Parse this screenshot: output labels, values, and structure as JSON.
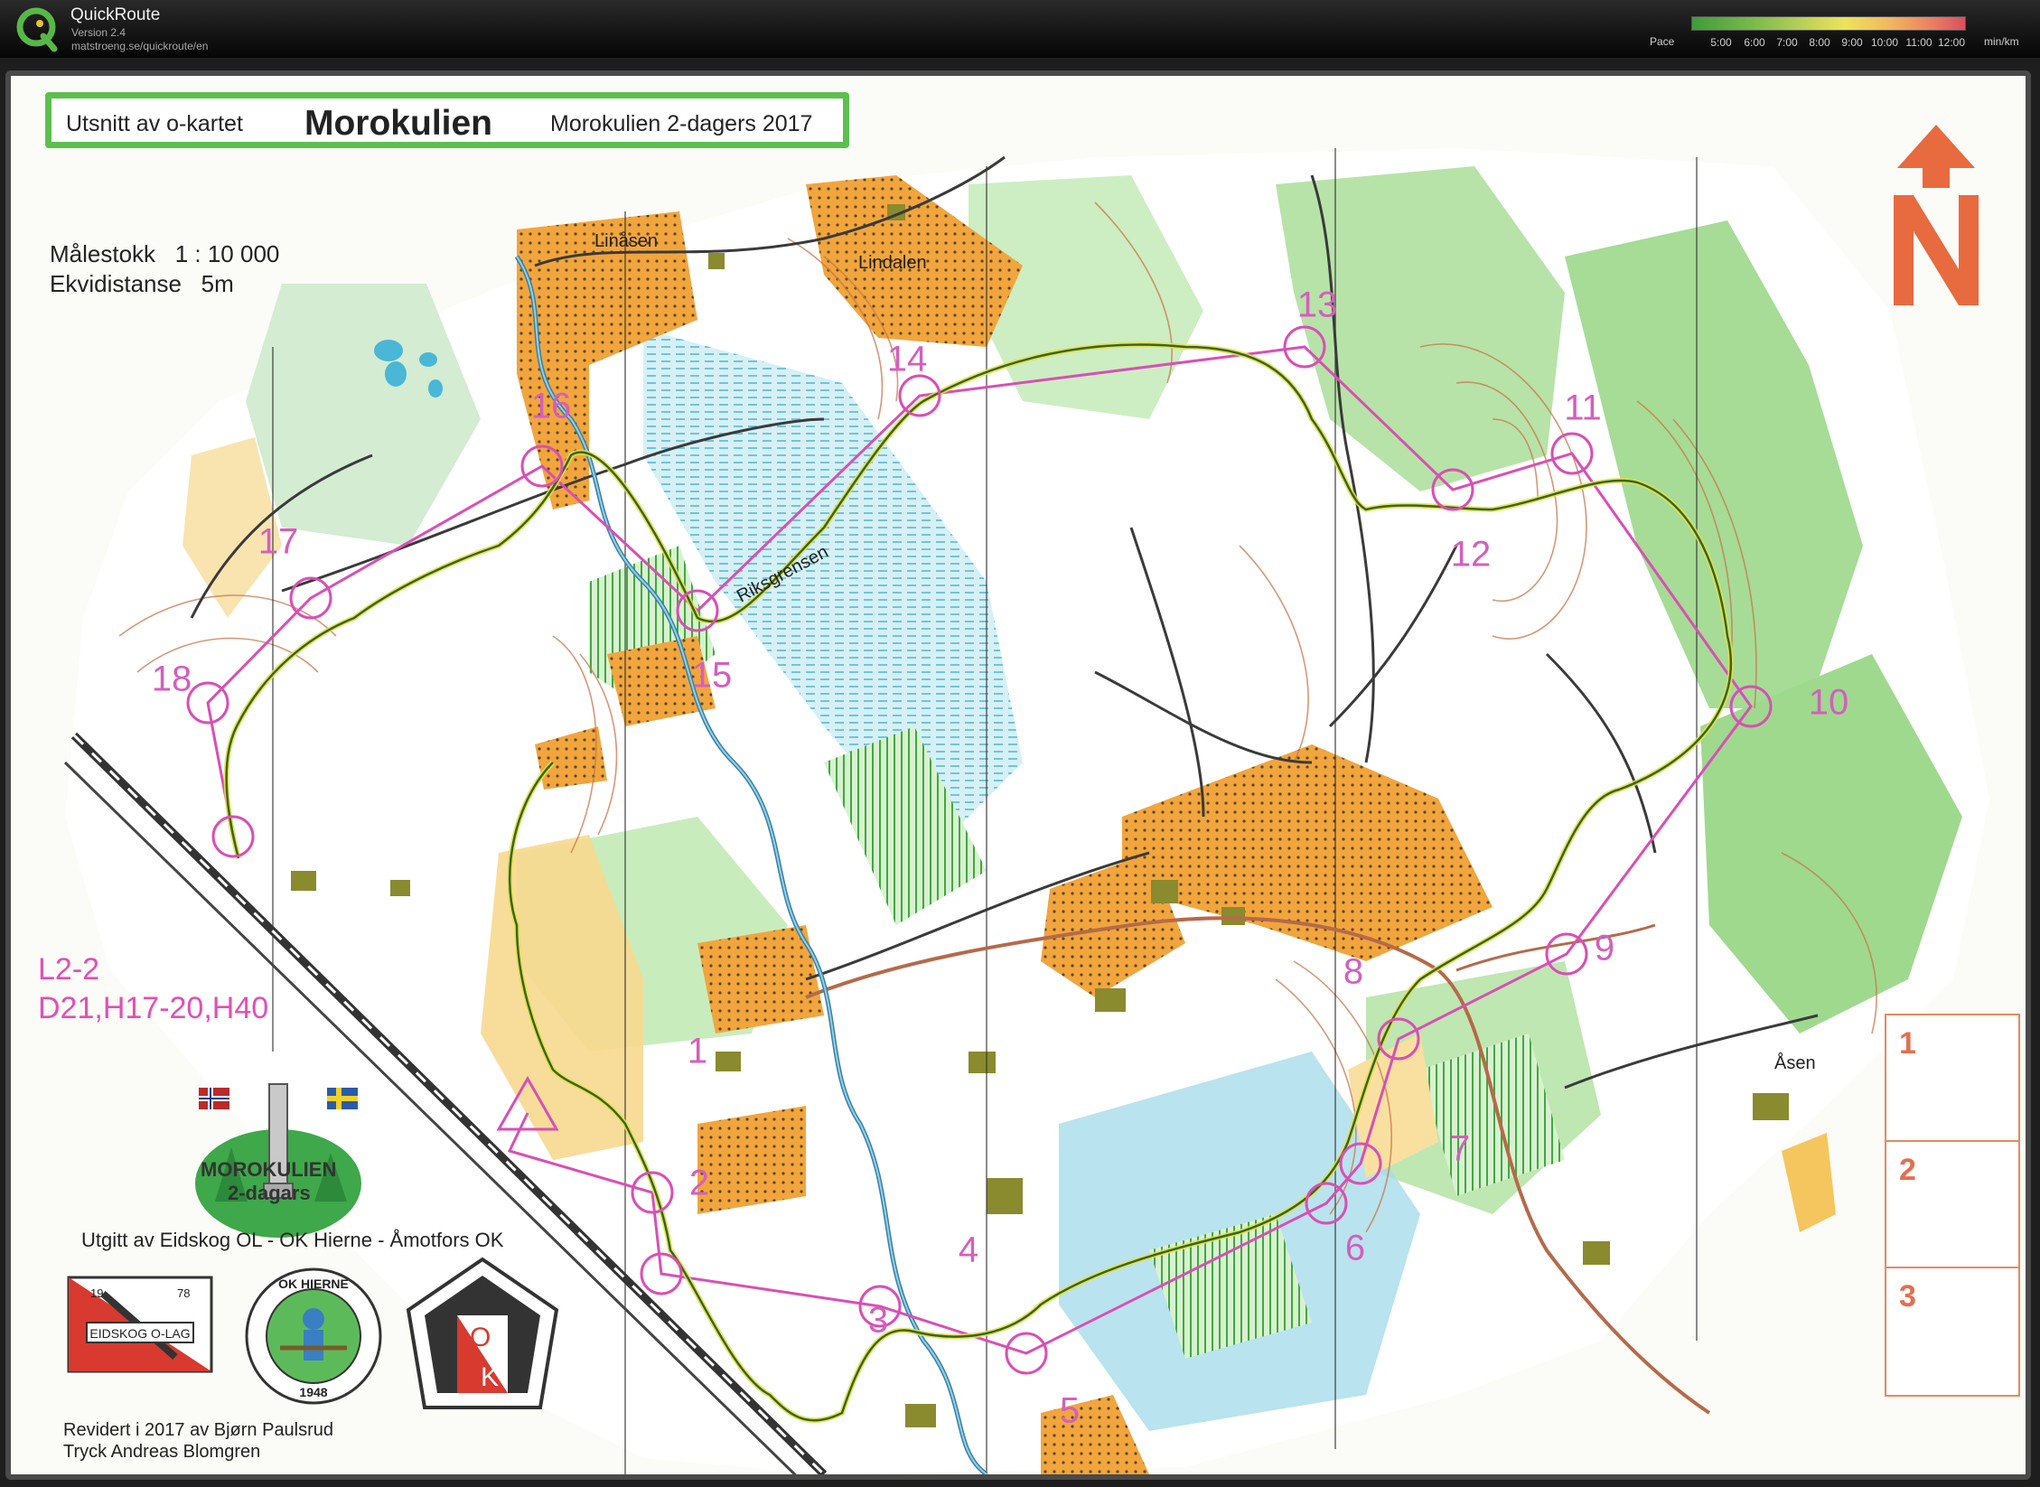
{
  "app": {
    "title": "QuickRoute",
    "version": "Version 2.4",
    "url": "matstroeng.se/quickroute/en",
    "logo_letter": "Q"
  },
  "pace_legend": {
    "label": "Pace",
    "ticks": [
      "5:00",
      "6:00",
      "7:00",
      "8:00",
      "9:00",
      "10:00",
      "11:00",
      "12:00"
    ],
    "unit": "min/km"
  },
  "map": {
    "title_excerpt": "Utsnitt av o-kartet",
    "title_main": "Morokulien",
    "title_event": "Morokulien 2-dagers 2017",
    "scale": "Målestokk   1 : 10 000",
    "contour": "Ekvidistanse   5m",
    "course_code": "L2-2",
    "course_classes": "D21,H17-20,H40",
    "event_logo_line1": "MOROKULIEN",
    "event_logo_line2": "2-dagars",
    "publisher": "Utgitt av Eidskog OL - OK Hierne - Åmotfors OK",
    "club_eidskog": {
      "name": "EIDSKOG O-LAG",
      "year_left": "19",
      "year_right": "78"
    },
    "club_hierne": {
      "name": "OK HIERNE",
      "year": "1948"
    },
    "club_amotfors": {
      "letters": [
        "O",
        "K"
      ]
    },
    "revised": "Revidert i 2017 av Bjørn Paulsrud",
    "printer": "Tryck Andreas Blomgren",
    "places": [
      "Linåsen",
      "Lindalen",
      "Riksgrensen",
      "Åsen"
    ],
    "legs": [
      "1",
      "2",
      "3"
    ],
    "controls": [
      "1",
      "2",
      "3",
      "4",
      "5",
      "6",
      "7",
      "8",
      "9",
      "10",
      "11",
      "12",
      "13",
      "14",
      "15",
      "16",
      "17",
      "18"
    ]
  },
  "colors": {
    "course": "#d94fb5",
    "route": "#2f6a1f",
    "track_highlight": "#eedb4a",
    "open_land": "#f2a53d",
    "vegetation": "#9dd78e",
    "water_marsh": "#8fd2e6",
    "contour": "#c8764a",
    "north_arrow": "#e86a3f"
  }
}
